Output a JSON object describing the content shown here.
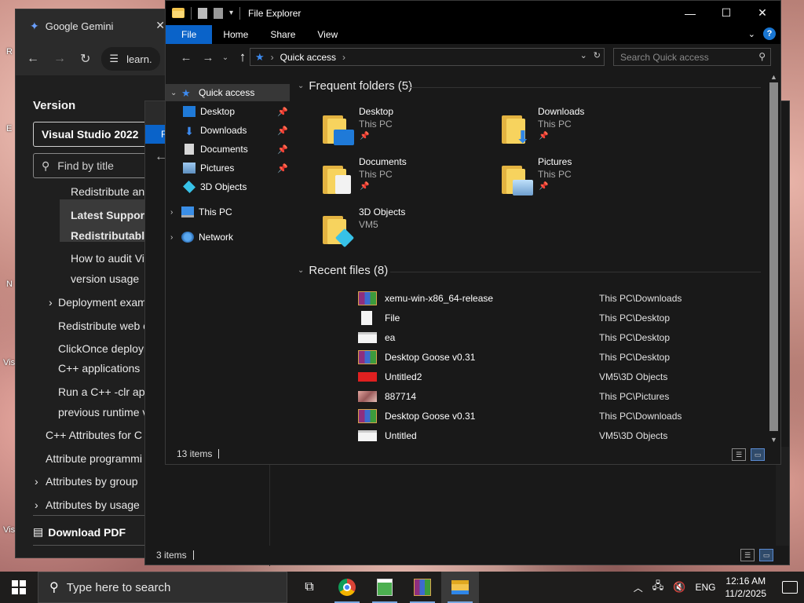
{
  "desktop": {
    "letters": [
      "R",
      "E",
      "N",
      "Vis",
      "Vis"
    ]
  },
  "browser": {
    "tab_title": "Google Gemini",
    "url_partial": "learn.",
    "doc": {
      "version_label": "Version",
      "version_value": "Visual Studio 2022",
      "filter_placeholder": "Find by title",
      "toc": [
        "Redistribute an",
        "Latest Supporte",
        "Redistributable",
        "How to audit Vi",
        "version usage",
        "Deployment exam",
        "Redistribute web c",
        "ClickOnce deploym",
        "C++ applications",
        "Run a C++ -clr ap",
        "previous runtime v",
        "C++ Attributes for C",
        "Attribute programmi",
        "Attributes by group",
        "Attributes by usage"
      ],
      "download_pdf": "Download PDF"
    }
  },
  "explorer_back": {
    "file_tab": "F",
    "status_items": "3 items"
  },
  "explorer": {
    "title": "File Explorer",
    "ribbon_tabs": [
      "File",
      "Home",
      "Share",
      "View"
    ],
    "help": "?",
    "address": {
      "location": "Quick access",
      "search_placeholder": "Search Quick access"
    },
    "nav": {
      "quick_access": "Quick access",
      "items": [
        "Desktop",
        "Downloads",
        "Documents",
        "Pictures",
        "3D Objects"
      ],
      "this_pc": "This PC",
      "network": "Network"
    },
    "frequent": {
      "header": "Frequent folders (5)",
      "folders": [
        {
          "name": "Desktop",
          "location": "This PC"
        },
        {
          "name": "Downloads",
          "location": "This PC"
        },
        {
          "name": "Documents",
          "location": "This PC"
        },
        {
          "name": "Pictures",
          "location": "This PC"
        },
        {
          "name": "3D Objects",
          "location": "VM5"
        }
      ]
    },
    "recent": {
      "header": "Recent files (8)",
      "files": [
        {
          "name": "xemu-win-x86_64-release",
          "path": "This PC\\Downloads",
          "icon": "archive-icon"
        },
        {
          "name": "File",
          "path": "This PC\\Desktop",
          "icon": "blank-file-icon"
        },
        {
          "name": "ea",
          "path": "This PC\\Desktop",
          "icon": "image-file-icon"
        },
        {
          "name": "Desktop Goose v0.31",
          "path": "This PC\\Desktop",
          "icon": "archive-icon"
        },
        {
          "name": "Untitled2",
          "path": "VM5\\3D Objects",
          "icon": "red-image-icon"
        },
        {
          "name": "887714",
          "path": "This PC\\Pictures",
          "icon": "photo-icon"
        },
        {
          "name": "Desktop Goose v0.31",
          "path": "This PC\\Downloads",
          "icon": "archive-icon"
        },
        {
          "name": "Untitled",
          "path": "VM5\\3D Objects",
          "icon": "image-file-icon"
        }
      ]
    },
    "status_items": "13 items"
  },
  "taskbar": {
    "search_placeholder": "Type here to search",
    "language": "ENG",
    "time": "12:16 AM",
    "date": "11/2/2025"
  },
  "colors": {
    "accent": "#0a63c9",
    "folder": "#f7d35e",
    "bg": "#191919"
  }
}
